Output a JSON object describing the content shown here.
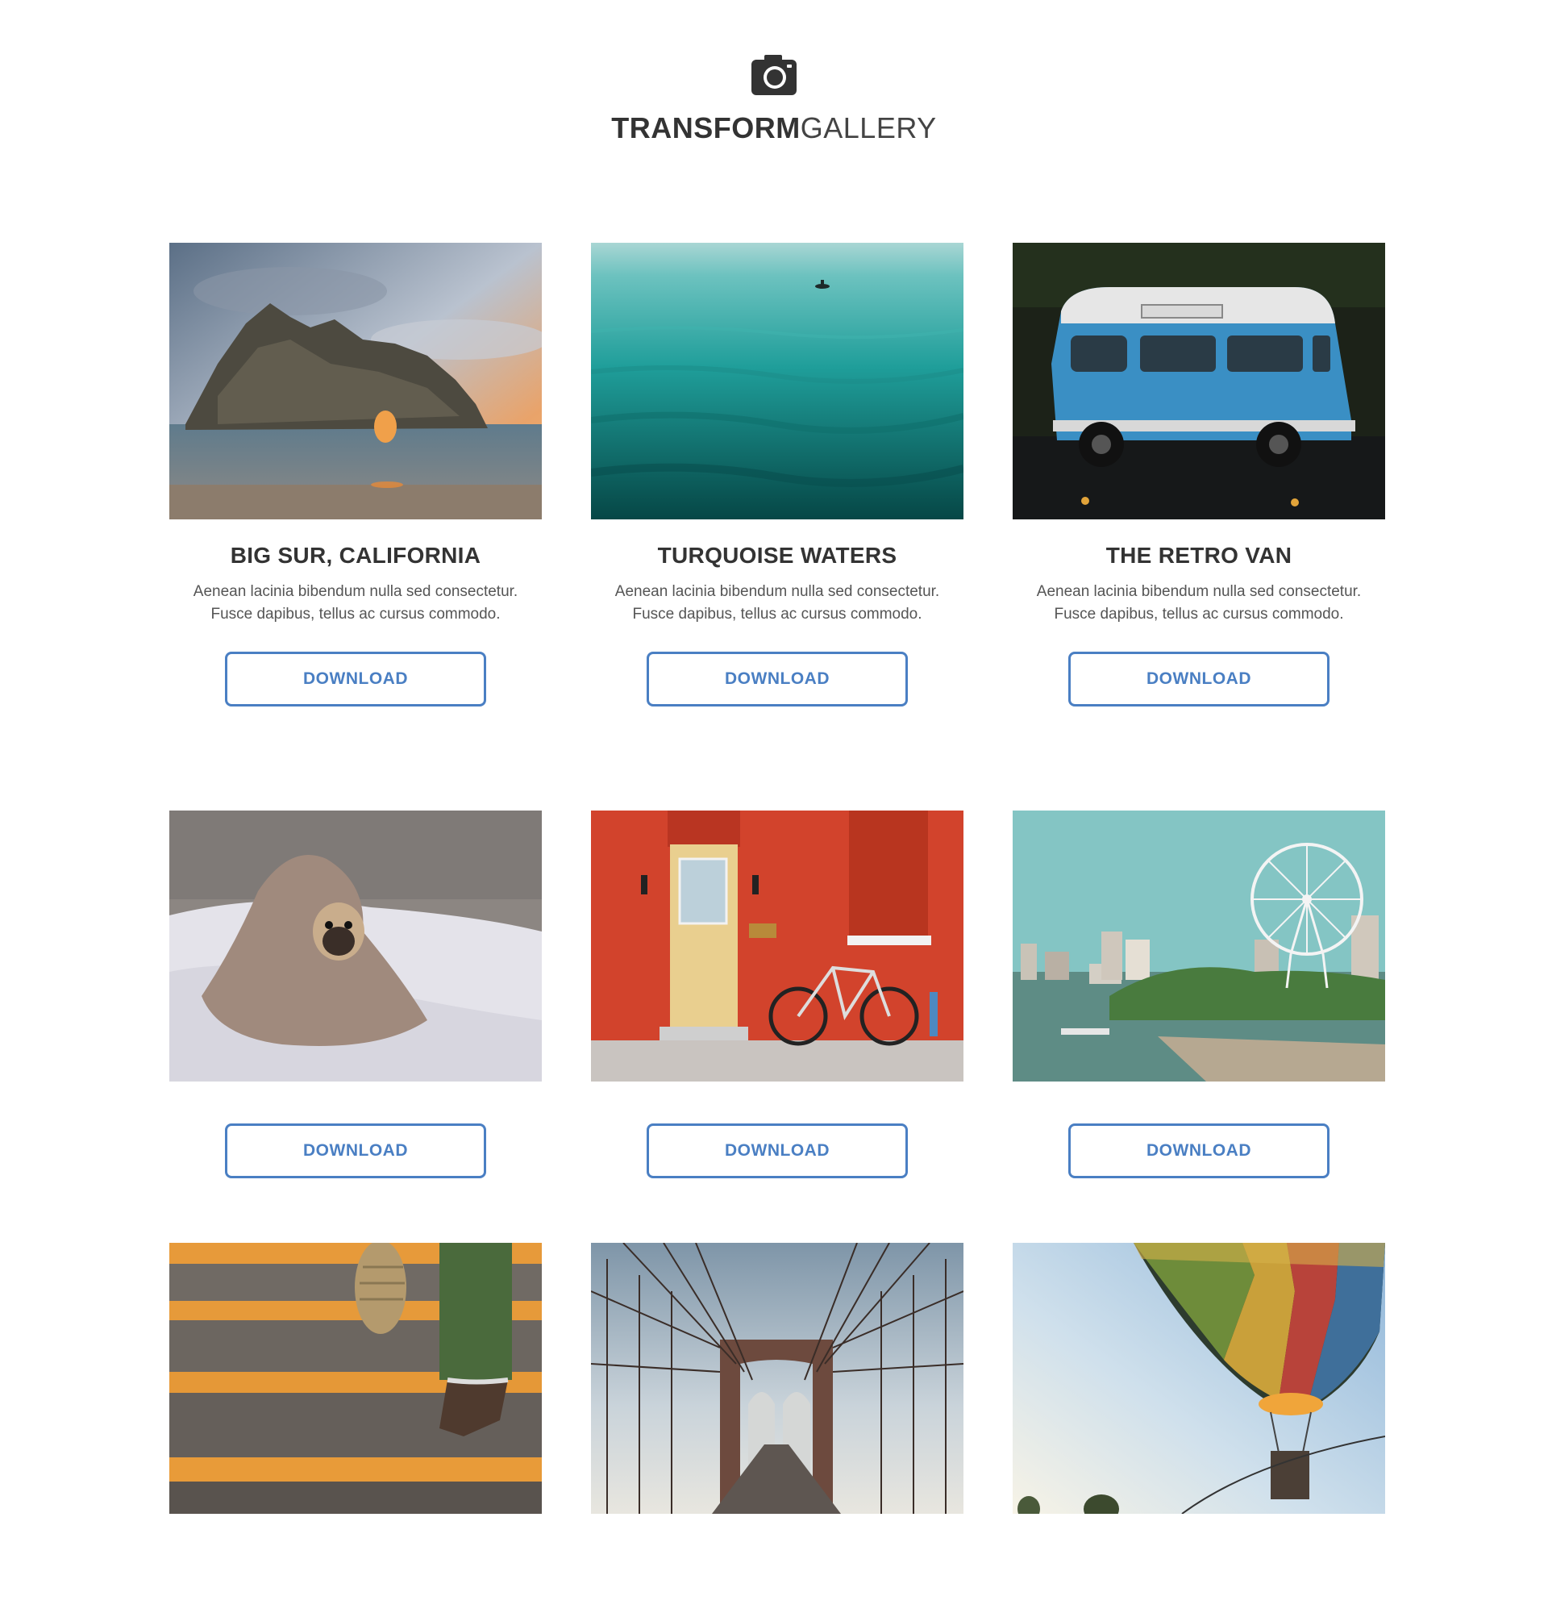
{
  "header": {
    "logo_bold": "TRANSFORM",
    "logo_light": "GALLERY",
    "icon": "camera-icon"
  },
  "accent_color": "#4a7fc3",
  "gallery": [
    {
      "title": "BIG SUR, CALIFORNIA",
      "description": "Aenean lacinia bibendum nulla sed consectetur. Fusce dapibus, tellus ac cursus commodo.",
      "button": "DOWNLOAD"
    },
    {
      "title": "TURQUOISE WATERS",
      "description": "Aenean lacinia bibendum nulla sed consectetur. Fusce dapibus, tellus ac cursus commodo.",
      "button": "DOWNLOAD"
    },
    {
      "title": "THE RETRO VAN",
      "description": "Aenean lacinia bibendum nulla sed consectetur. Fusce dapibus, tellus ac cursus commodo.",
      "button": "DOWNLOAD"
    },
    {
      "button": "DOWNLOAD"
    },
    {
      "button": "DOWNLOAD"
    },
    {
      "button": "DOWNLOAD"
    },
    {},
    {},
    {}
  ]
}
